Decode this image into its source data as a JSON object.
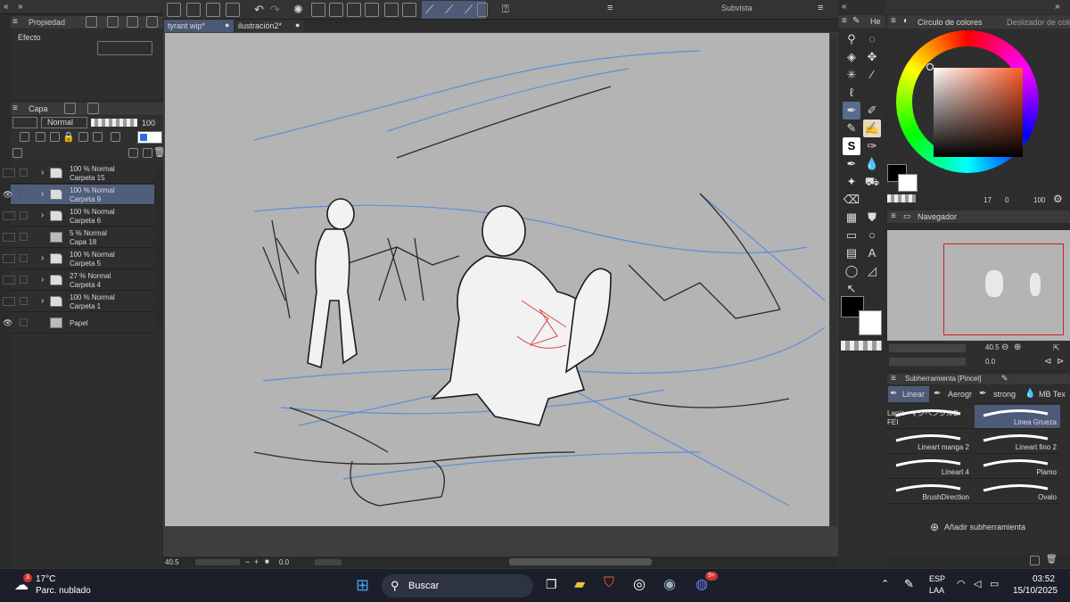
{
  "app": {
    "subview_title": "Subvista",
    "tabs": [
      {
        "label": "tyrant wip*"
      },
      {
        "label": "ilustración2*"
      }
    ]
  },
  "left": {
    "properties_tab": "Propiedad",
    "effect_label": "Efecto",
    "layer_tab": "Capa",
    "blend_mode": "Normal",
    "opacity": "100",
    "layers": [
      {
        "line1": "100 % Normal",
        "line2": "Carpeta 15",
        "visible": false,
        "selected": false,
        "folder": true
      },
      {
        "line1": "100 % Normal",
        "line2": "Carpeta 9",
        "visible": true,
        "selected": true,
        "folder": true
      },
      {
        "line1": "100 % Normal",
        "line2": "Carpeta 6",
        "visible": false,
        "selected": false,
        "folder": true
      },
      {
        "line1": "5 % Normal",
        "line2": "Capa 18",
        "visible": false,
        "selected": false,
        "folder": false
      },
      {
        "line1": "100 % Normal",
        "line2": "Carpeta 5",
        "visible": false,
        "selected": false,
        "folder": true
      },
      {
        "line1": "27 % Normal",
        "line2": "Carpeta 4",
        "visible": false,
        "selected": false,
        "folder": true
      },
      {
        "line1": "100 % Normal",
        "line2": "Carpeta 1",
        "visible": false,
        "selected": false,
        "folder": true
      },
      {
        "line1": "",
        "line2": "Papel",
        "visible": true,
        "selected": false,
        "folder": false
      }
    ]
  },
  "status": {
    "zoom": "40.5",
    "angle": "0.0"
  },
  "right": {
    "tool_tab": "He",
    "color_wheel_tab": "Círculo de colores",
    "color_slider_tab": "Deslizador de colores",
    "hsv_values": {
      "h": "17",
      "s": "0",
      "v": "100"
    },
    "navigator_tab": "Navegador",
    "nav_zoom": "40.5",
    "nav_angle": "0.0",
    "subtool_tab": "Subherramienta [Pincel]",
    "subtool_groups": [
      "Linear",
      "Aerogr",
      "strong",
      "MB Tex"
    ],
    "brushes": [
      "Lapiz - マジペンシルD FEI",
      "Linea Grueza",
      "Lineart manga 2",
      "Lineart fino 2",
      "Lineart 4",
      "Plamo",
      "BrushDirection",
      "Ovalo"
    ],
    "add_subtool": "Añadir subherramienta"
  },
  "taskbar": {
    "weather_temp": "17°C",
    "weather_desc": "Parc. nublado",
    "weather_badge": "3",
    "search_placeholder": "Buscar",
    "lang": "ESP",
    "lang2": "LAA",
    "time": "03:52",
    "date": "15/10/2025",
    "discord_badge": "9+"
  },
  "colors": {
    "accent": "#5a6b8c",
    "canvas": "#b4b4b4",
    "taskbar": "#1b1f2a"
  }
}
